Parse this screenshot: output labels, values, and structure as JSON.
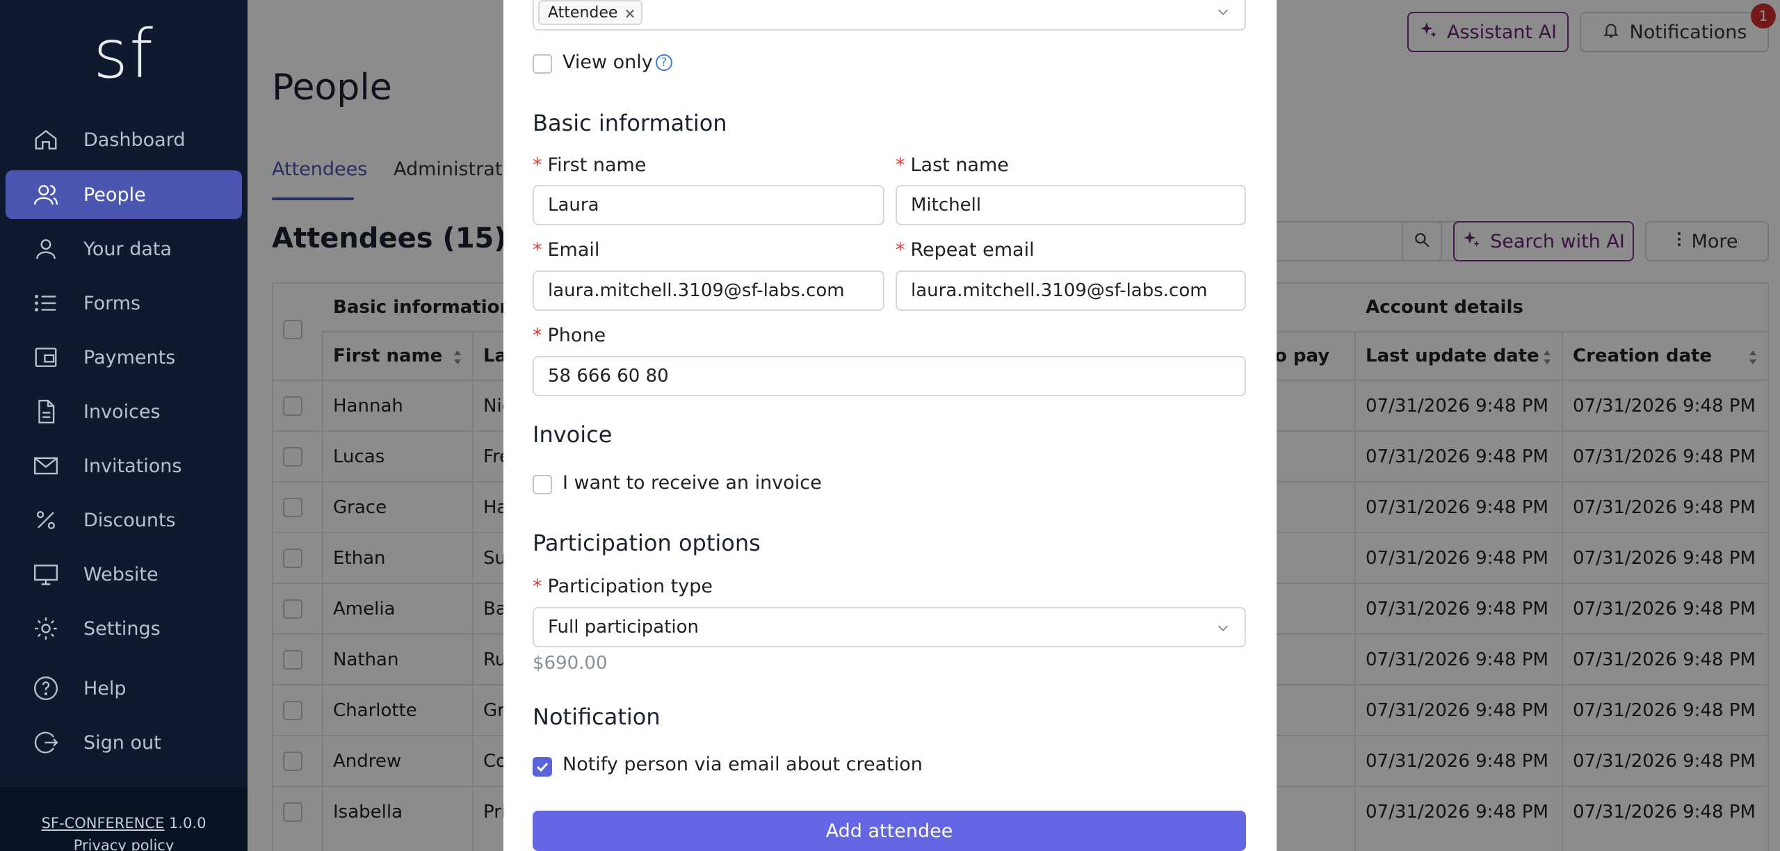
{
  "sidebar": {
    "logo": "sf",
    "items": [
      {
        "label": "Dashboard",
        "icon": "home-icon"
      },
      {
        "label": "People",
        "icon": "people-icon"
      },
      {
        "label": "Your data",
        "icon": "user-icon"
      },
      {
        "label": "Forms",
        "icon": "list-icon"
      },
      {
        "label": "Payments",
        "icon": "wallet-icon"
      },
      {
        "label": "Invoices",
        "icon": "document-icon"
      },
      {
        "label": "Invitations",
        "icon": "envelope-icon"
      },
      {
        "label": "Discounts",
        "icon": "percent-icon"
      },
      {
        "label": "Website",
        "icon": "monitor-icon"
      },
      {
        "label": "Settings",
        "icon": "gear-icon"
      },
      {
        "label": "Help",
        "icon": "question-icon"
      },
      {
        "label": "Sign out",
        "icon": "sign-out-icon"
      }
    ],
    "footer": {
      "brand": "SF-CONFERENCE",
      "version": "1.0.0",
      "privacy": "Privacy policy"
    }
  },
  "header": {
    "title": "People",
    "assistant_label": "Assistant AI",
    "notifications_label": "Notifications",
    "notifications_count": "1"
  },
  "tabs": [
    "Attendees",
    "Administrators"
  ],
  "list": {
    "title": "Attendees (15)",
    "search_ai_label": "Search with AI",
    "more_label": "More"
  },
  "table": {
    "group_basic": "Basic information",
    "group_account": "Account details",
    "col_first": "First name",
    "col_last_partial": "La",
    "col_topay_partial": "o pay",
    "col_last_update": "Last update date",
    "col_creation": "Creation date",
    "rows": [
      {
        "first": "Hannah",
        "last": "Nic",
        "updated": "07/31/2026 9:48 PM",
        "created": "07/31/2026 9:48 PM"
      },
      {
        "first": "Lucas",
        "last": "Fre",
        "updated": "07/31/2026 9:48 PM",
        "created": "07/31/2026 9:48 PM"
      },
      {
        "first": "Grace",
        "last": "Ha",
        "updated": "07/31/2026 9:48 PM",
        "created": "07/31/2026 9:48 PM"
      },
      {
        "first": "Ethan",
        "last": "Su",
        "updated": "07/31/2026 9:48 PM",
        "created": "07/31/2026 9:48 PM"
      },
      {
        "first": "Amelia",
        "last": "Ba",
        "updated": "07/31/2026 9:48 PM",
        "created": "07/31/2026 9:48 PM"
      },
      {
        "first": "Nathan",
        "last": "Ru",
        "updated": "07/31/2026 9:48 PM",
        "created": "07/31/2026 9:48 PM"
      },
      {
        "first": "Charlotte",
        "last": "Gr",
        "updated": "07/31/2026 9:48 PM",
        "created": "07/31/2026 9:48 PM"
      },
      {
        "first": "Andrew",
        "last": "Co",
        "updated": "07/31/2026 9:48 PM",
        "created": "07/31/2026 9:48 PM"
      },
      {
        "first": "Isabella",
        "last": "Pri",
        "updated": "07/31/2026 9:48 PM",
        "created": "07/31/2026 9:48 PM"
      }
    ]
  },
  "modal": {
    "role_chip": "Attendee",
    "view_only_label": "View only",
    "basic_heading": "Basic information",
    "first_name_label": "First name",
    "first_name_value": "Laura",
    "last_name_label": "Last name",
    "last_name_value": "Mitchell",
    "email_label": "Email",
    "email_value": "laura.mitchell.3109@sf-labs.com",
    "repeat_email_label": "Repeat email",
    "repeat_email_value": "laura.mitchell.3109@sf-labs.com",
    "phone_label": "Phone",
    "phone_value": "58 666 60 80",
    "invoice_heading": "Invoice",
    "invoice_label": "I want to receive an invoice",
    "participation_heading": "Participation options",
    "participation_type_label": "Participation type",
    "participation_type_value": "Full participation",
    "price": "$690.00",
    "notification_heading": "Notification",
    "notify_label": "Notify person via email about creation",
    "notify_checked": true,
    "submit_label": "Add attendee"
  },
  "colors": {
    "sidebar_bg": "#101a2e",
    "accent": "#4a56b0",
    "ai_accent": "#7c2d86",
    "primary_button": "#6466e4",
    "badge": "#d32f2f"
  }
}
